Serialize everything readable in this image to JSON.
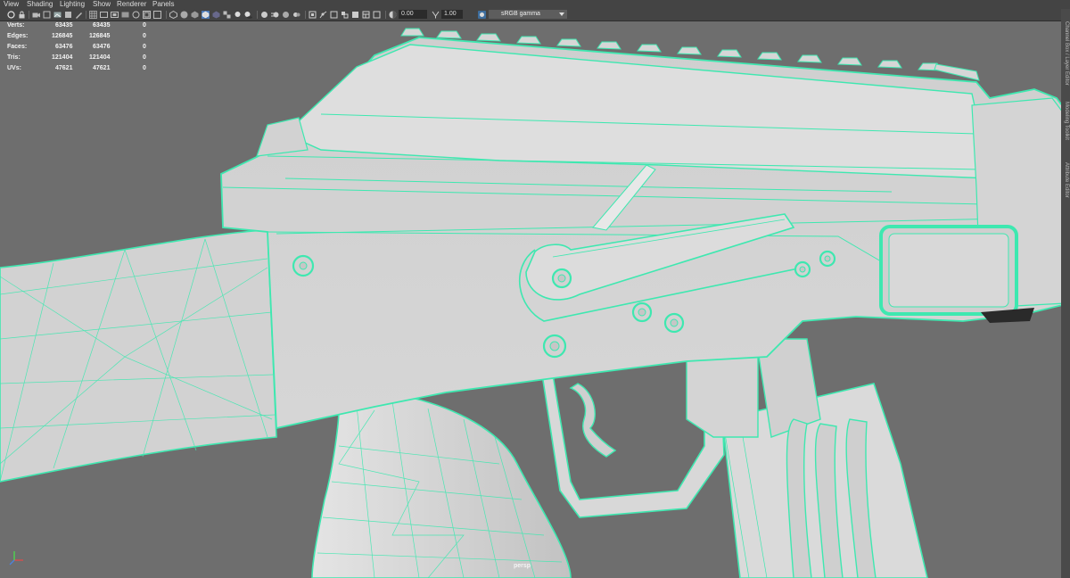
{
  "menu": {
    "items": [
      "View",
      "Shading",
      "Lighting",
      "Show",
      "Renderer",
      "Panels"
    ]
  },
  "toolbar": {
    "exposure_value": "0.00",
    "gamma_value": "1.00",
    "color_space": "sRGB gamma"
  },
  "hud": {
    "rows": [
      {
        "label": "Verts:",
        "selected": "63435",
        "total": "63435",
        "components": "0"
      },
      {
        "label": "Edges:",
        "selected": "126845",
        "total": "126845",
        "components": "0"
      },
      {
        "label": "Faces:",
        "selected": "63476",
        "total": "63476",
        "components": "0"
      },
      {
        "label": "Tris:",
        "selected": "121404",
        "total": "121404",
        "components": "0"
      },
      {
        "label": "UVs:",
        "selected": "47621",
        "total": "47621",
        "components": "0"
      }
    ]
  },
  "viewport": {
    "camera": "persp",
    "background_color": "#6e6e6e",
    "mesh_fill_color": "#d8d8d8",
    "wireframe_color": "#3ee8b0"
  },
  "sidebar": {
    "tabs": [
      "Channel Box / Layer Editor",
      "Modeling Toolkit",
      "Attribute Editor"
    ]
  }
}
